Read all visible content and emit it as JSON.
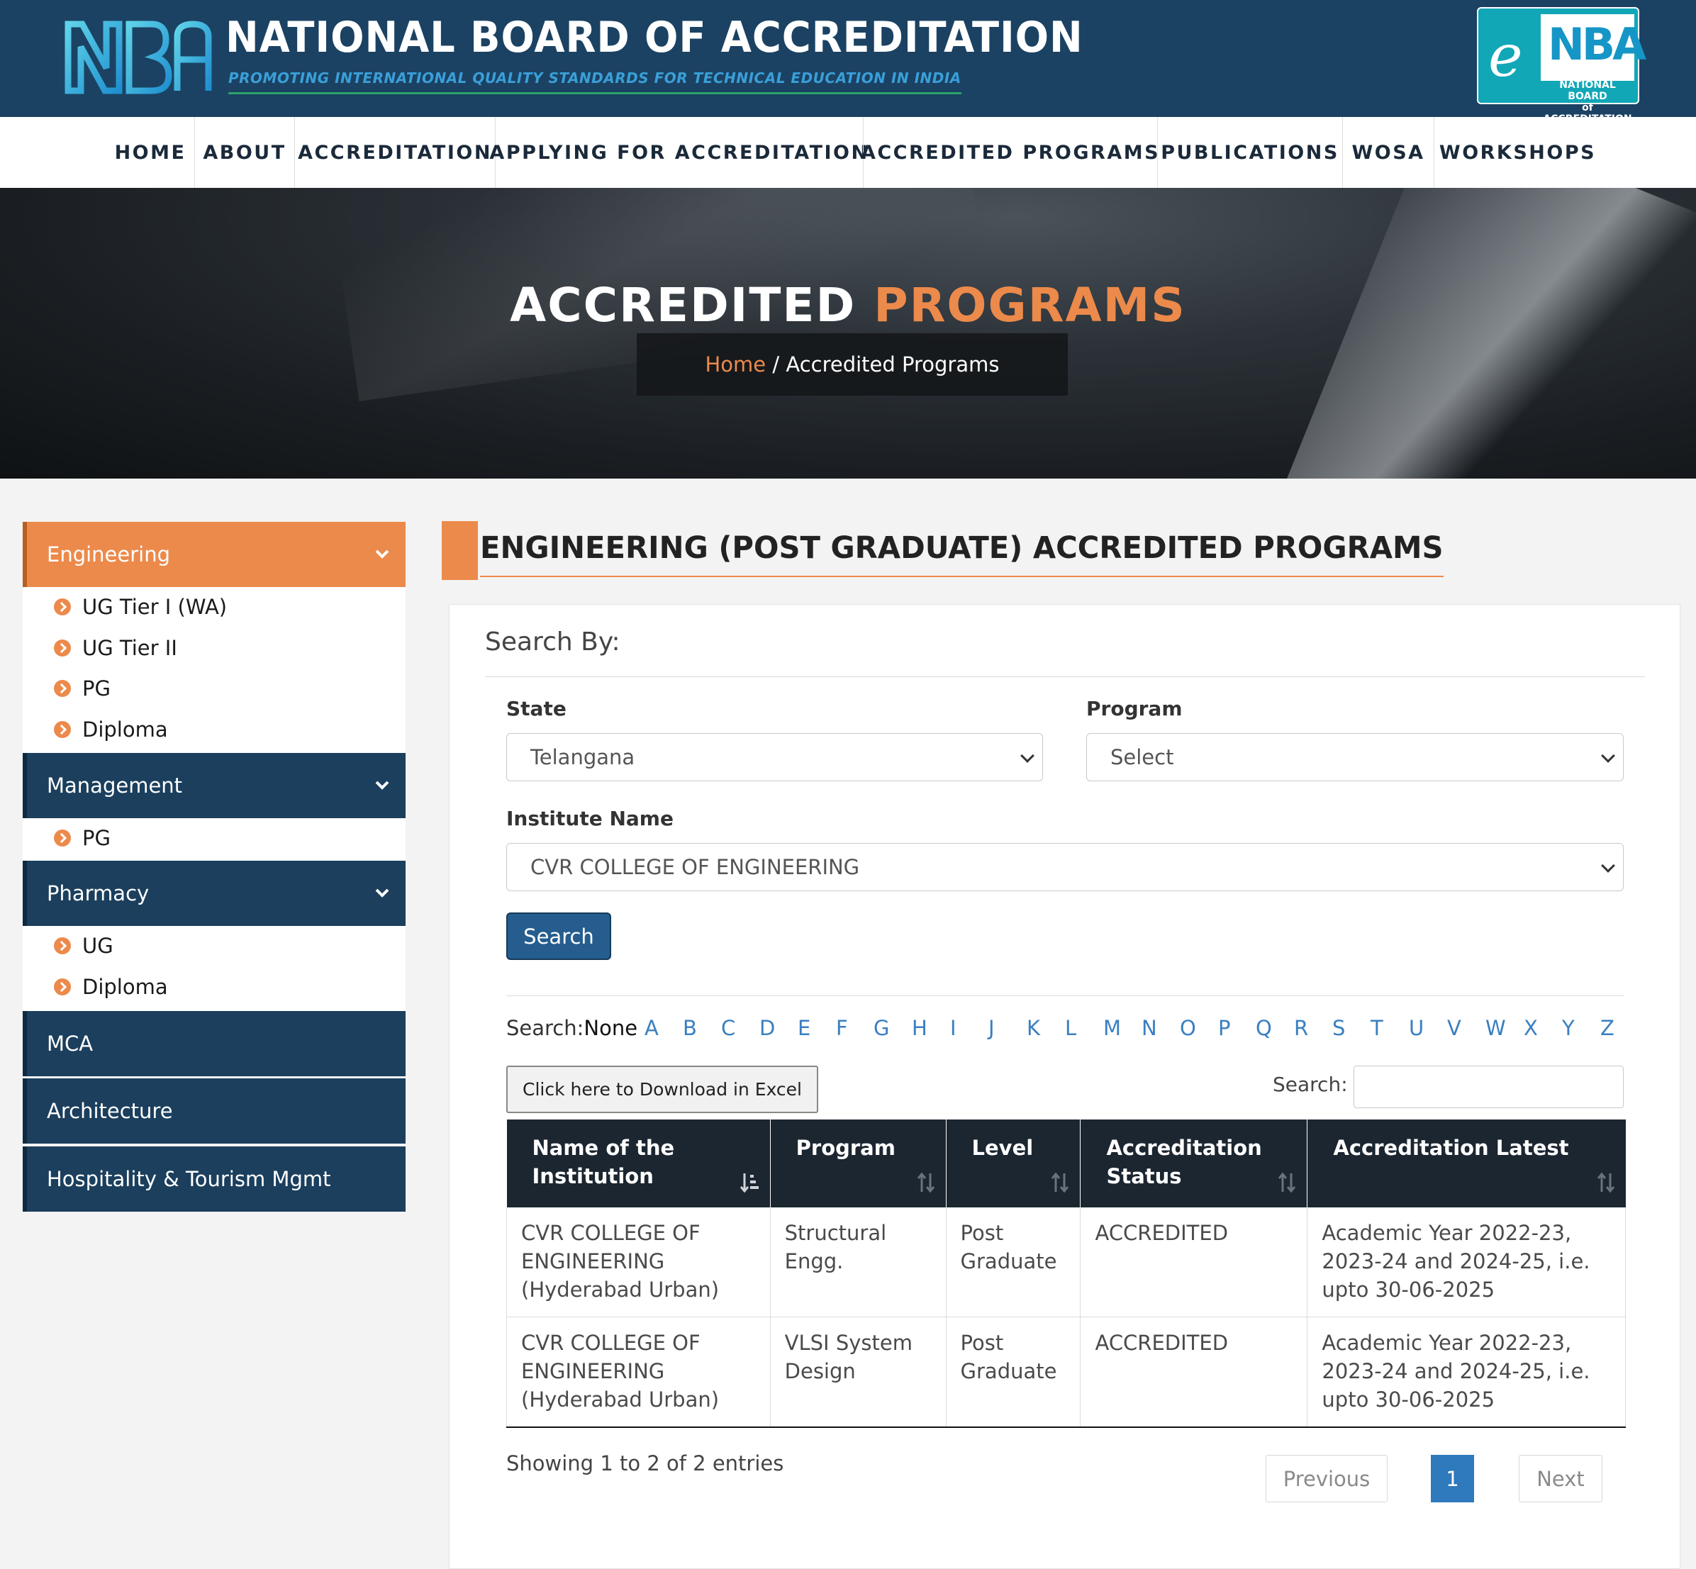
{
  "brand": {
    "title": "NATIONAL BOARD OF ACCREDITATION",
    "tagline": "PROMOTING INTERNATIONAL QUALITY STANDARDS FOR TECHNICAL EDUCATION IN INDIA",
    "enba_prefix": "e",
    "enba_mark": "NBA",
    "enba_sub1": "NATIONAL BOARD",
    "enba_sub2": "of ACCREDITATION"
  },
  "nav": [
    "HOME",
    "ABOUT",
    "ACCREDITATION",
    "APPLYING FOR ACCREDITATION",
    "ACCREDITED PROGRAMS",
    "PUBLICATIONS",
    "WOSA",
    "WORKSHOPS"
  ],
  "hero": {
    "title_white": "ACCREDITED ",
    "title_accent": "PROGRAMS",
    "crumb_home": "Home",
    "crumb_sep": " / ",
    "crumb_current": "Accredited Programs"
  },
  "sidebar": {
    "engineering": "Engineering",
    "engineering_items": [
      "UG Tier I (WA)",
      "UG Tier II",
      "PG",
      "Diploma"
    ],
    "management": "Management",
    "management_items": [
      "PG"
    ],
    "pharmacy": "Pharmacy",
    "pharmacy_items": [
      "UG",
      "Diploma"
    ],
    "mca": "MCA",
    "architecture": "Architecture",
    "hospitality": "Hospitality & Tourism Mgmt"
  },
  "main": {
    "section_title": "ENGINEERING (POST GRADUATE) ACCREDITED PROGRAMS",
    "search_by": "Search By:",
    "state_label": "State",
    "state_value": "Telangana",
    "program_label": "Program",
    "program_value": "Select",
    "institute_label": "Institute Name",
    "institute_value": "CVR COLLEGE OF ENGINEERING",
    "search_button": "Search",
    "alpha_prefix": "Search:",
    "alpha_none": "None",
    "letters": [
      "A",
      "B",
      "C",
      "D",
      "E",
      "F",
      "G",
      "H",
      "I",
      "J",
      "K",
      "L",
      "M",
      "N",
      "O",
      "P",
      "Q",
      "R",
      "S",
      "T",
      "U",
      "V",
      "W",
      "X",
      "Y",
      "Z"
    ],
    "excel_button": "Click here to Download in Excel",
    "table_search_label": "Search:",
    "table_search_value": ""
  },
  "table": {
    "headers": [
      "Name of the Institution",
      "Program",
      "Level",
      "Accreditation Status",
      "Accreditation Latest"
    ],
    "rows": [
      [
        "CVR COLLEGE OF ENGINEERING (Hyderabad Urban)",
        "Structural Engg.",
        "Post Graduate",
        "ACCREDITED",
        "Academic Year 2022-23, 2023-24 and 2024-25, i.e. upto 30-06-2025"
      ],
      [
        "CVR COLLEGE OF ENGINEERING (Hyderabad Urban)",
        "VLSI System Design",
        "Post Graduate",
        "ACCREDITED",
        "Academic Year 2022-23, 2023-24 and 2024-25, i.e. upto 30-06-2025"
      ]
    ],
    "info": "Showing 1 to 2 of 2 entries",
    "prev": "Previous",
    "page": "1",
    "next": "Next"
  },
  "colors": {
    "header_bg": "#1b4263",
    "accent_orange": "#ec8a4b",
    "sidebar_blue": "#1b3f5d",
    "table_header": "#1c2631",
    "link_blue": "#3a7fc1"
  }
}
